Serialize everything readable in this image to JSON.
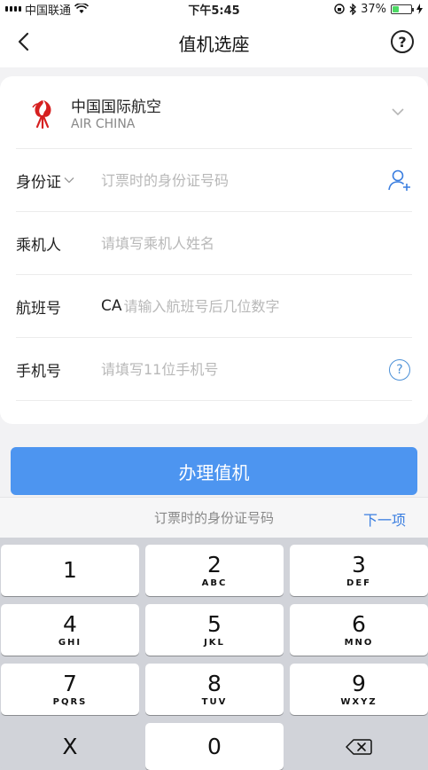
{
  "status_bar": {
    "carrier": "中国联通",
    "time": "下午5:45",
    "battery_percent": "37%",
    "battery_level": 0.37
  },
  "nav": {
    "title": "值机选座"
  },
  "airline": {
    "name_cn": "中国国际航空",
    "name_en": "AIR CHINA"
  },
  "form": {
    "id_label": "身份证",
    "id_placeholder": "订票时的身份证号码",
    "passenger_label": "乘机人",
    "passenger_placeholder": "请填写乘机人姓名",
    "flight_label": "航班号",
    "flight_prefix": "CA",
    "flight_placeholder": "请输入航班号后几位数字",
    "phone_label": "手机号",
    "phone_placeholder": "请填写11位手机号"
  },
  "submit": {
    "label": "办理值机"
  },
  "keyboard_accessory": {
    "hint": "订票时的身份证号码",
    "next_label": "下一项"
  },
  "keypad": {
    "keys": [
      {
        "digit": "1",
        "letters": ""
      },
      {
        "digit": "2",
        "letters": "ABC"
      },
      {
        "digit": "3",
        "letters": "DEF"
      },
      {
        "digit": "4",
        "letters": "GHI"
      },
      {
        "digit": "5",
        "letters": "JKL"
      },
      {
        "digit": "6",
        "letters": "MNO"
      },
      {
        "digit": "7",
        "letters": "PQRS"
      },
      {
        "digit": "8",
        "letters": "TUV"
      },
      {
        "digit": "9",
        "letters": "WXYZ"
      }
    ],
    "x_key": "X",
    "zero_key": "0"
  },
  "colors": {
    "accent": "#4d95f0",
    "link": "#3a7ee0",
    "brand_red": "#d62020"
  }
}
